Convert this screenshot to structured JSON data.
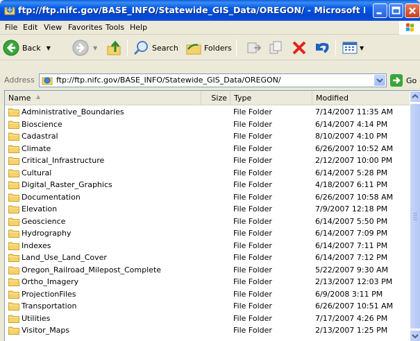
{
  "window": {
    "title": "ftp://ftp.nifc.gov/BASE_INFO/Statewide_GIS_Data/OREGON/ - Microsoft Int..."
  },
  "menu": {
    "file": "File",
    "edit": "Edit",
    "view": "View",
    "favorites": "Favorites",
    "tools": "Tools",
    "help": "Help"
  },
  "toolbar": {
    "back_label": "Back",
    "search_label": "Search",
    "folders_label": "Folders"
  },
  "address": {
    "label": "Address",
    "value": "ftp://ftp.nifc.gov/BASE_INFO/Statewide_GIS_Data/OREGON/",
    "go_label": "Go"
  },
  "list": {
    "columns": {
      "name": "Name",
      "size": "Size",
      "type": "Type",
      "modified": "Modified"
    },
    "rows": [
      {
        "name": "Administrative_Boundaries",
        "size": "",
        "type": "File Folder",
        "modified": "7/14/2007 11:35 AM"
      },
      {
        "name": "Bioscience",
        "size": "",
        "type": "File Folder",
        "modified": "6/14/2007 4:14 PM"
      },
      {
        "name": "Cadastral",
        "size": "",
        "type": "File Folder",
        "modified": "8/10/2007 4:10 PM"
      },
      {
        "name": "Climate",
        "size": "",
        "type": "File Folder",
        "modified": "6/26/2007 10:52 AM"
      },
      {
        "name": "Critical_Infrastructure",
        "size": "",
        "type": "File Folder",
        "modified": "2/12/2007 10:00 PM"
      },
      {
        "name": "Cultural",
        "size": "",
        "type": "File Folder",
        "modified": "6/14/2007 5:28 PM"
      },
      {
        "name": "Digital_Raster_Graphics",
        "size": "",
        "type": "File Folder",
        "modified": "4/18/2007 6:11 PM"
      },
      {
        "name": "Documentation",
        "size": "",
        "type": "File Folder",
        "modified": "6/26/2007 10:58 AM"
      },
      {
        "name": "Elevation",
        "size": "",
        "type": "File Folder",
        "modified": "7/9/2007 12:18 PM"
      },
      {
        "name": "Geoscience",
        "size": "",
        "type": "File Folder",
        "modified": "6/14/2007 5:50 PM"
      },
      {
        "name": "Hydrography",
        "size": "",
        "type": "File Folder",
        "modified": "6/14/2007 7:09 PM"
      },
      {
        "name": "Indexes",
        "size": "",
        "type": "File Folder",
        "modified": "6/14/2007 7:11 PM"
      },
      {
        "name": "Land_Use_Land_Cover",
        "size": "",
        "type": "File Folder",
        "modified": "6/14/2007 7:12 PM"
      },
      {
        "name": "Oregon_Railroad_Milepost_Complete",
        "size": "",
        "type": "File Folder",
        "modified": "5/22/2007 9:30 AM"
      },
      {
        "name": "Ortho_Imagery",
        "size": "",
        "type": "File Folder",
        "modified": "2/13/2007 12:03 PM"
      },
      {
        "name": "ProjectionFiles",
        "size": "",
        "type": "File Folder",
        "modified": "6/9/2008 3:11 PM"
      },
      {
        "name": "Transportation",
        "size": "",
        "type": "File Folder",
        "modified": "6/26/2007 10:51 AM"
      },
      {
        "name": "Utilities",
        "size": "",
        "type": "File Folder",
        "modified": "7/17/2007 4:26 PM"
      },
      {
        "name": "Visitor_Maps",
        "size": "",
        "type": "File Folder",
        "modified": "2/13/2007 1:25 PM"
      }
    ]
  },
  "colors": {
    "titlebar": "#0054e3",
    "folder_fill": "#f5d36a",
    "folder_edge": "#c9a02c",
    "delete_red": "#e2231a"
  }
}
